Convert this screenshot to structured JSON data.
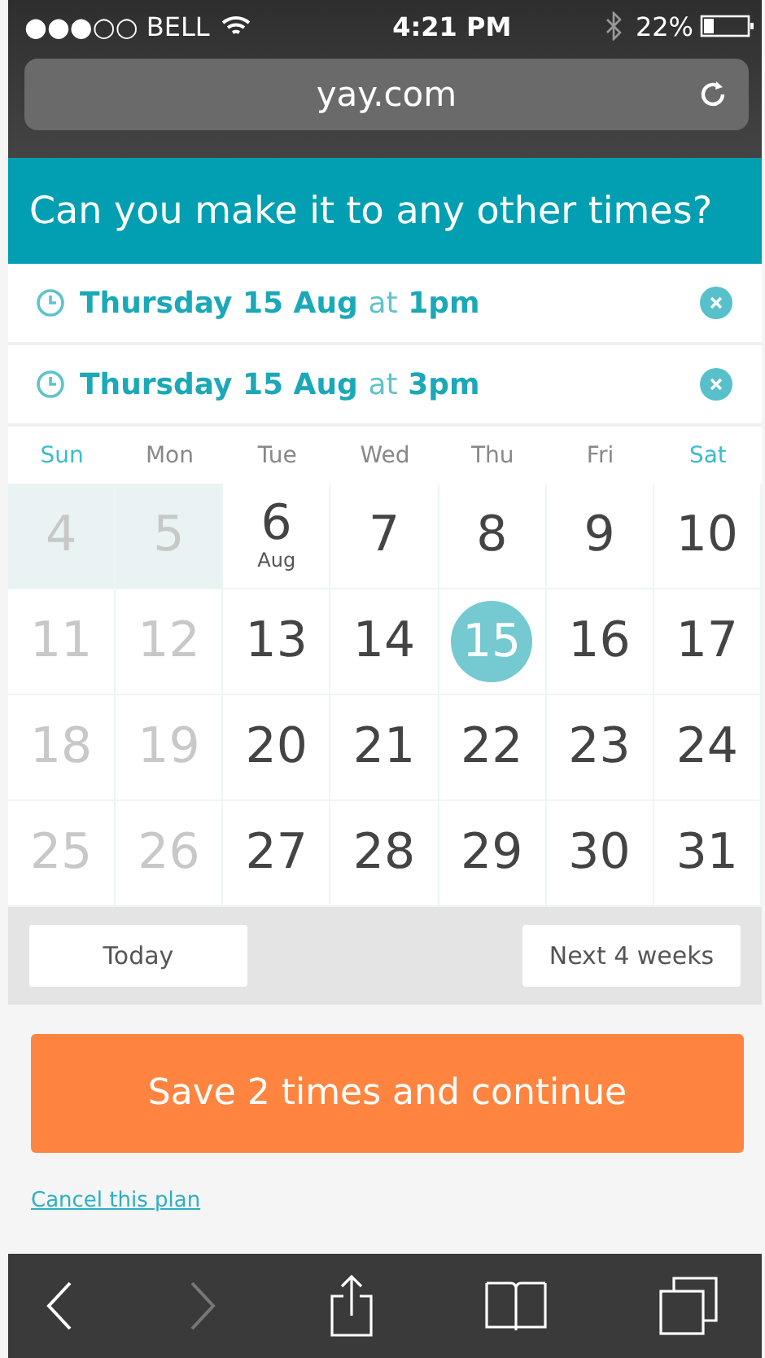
{
  "status_bar": {
    "carrier": "●●●○○ BELL",
    "time": "4:21 PM",
    "battery": "22%"
  },
  "url_bar": {
    "url": "yay.com"
  },
  "header": {
    "title": "Can you make it to any other times?"
  },
  "times": [
    {
      "date": "Thursday 15 Aug",
      "connector": "at",
      "time": "1pm"
    },
    {
      "date": "Thursday 15 Aug",
      "connector": "at",
      "time": "3pm"
    }
  ],
  "weekdays": [
    {
      "label": "Sun",
      "weekend": true
    },
    {
      "label": "Mon",
      "weekend": false
    },
    {
      "label": "Tue",
      "weekend": false
    },
    {
      "label": "Wed",
      "weekend": false
    },
    {
      "label": "Thu",
      "weekend": false
    },
    {
      "label": "Fri",
      "weekend": false
    },
    {
      "label": "Sat",
      "weekend": true
    }
  ],
  "days": [
    {
      "day": "4",
      "past": true,
      "shaded": true,
      "selected": false
    },
    {
      "day": "5",
      "past": true,
      "shaded": true,
      "selected": false
    },
    {
      "day": "6",
      "month": "Aug",
      "past": false,
      "shaded": false,
      "selected": false
    },
    {
      "day": "7",
      "past": false,
      "shaded": false,
      "selected": false
    },
    {
      "day": "8",
      "past": false,
      "shaded": false,
      "selected": false
    },
    {
      "day": "9",
      "past": false,
      "shaded": false,
      "selected": false
    },
    {
      "day": "10",
      "past": false,
      "shaded": false,
      "selected": false
    },
    {
      "day": "11",
      "past": true,
      "shaded": false,
      "selected": false
    },
    {
      "day": "12",
      "past": true,
      "shaded": false,
      "selected": false
    },
    {
      "day": "13",
      "past": false,
      "shaded": false,
      "selected": false
    },
    {
      "day": "14",
      "past": false,
      "shaded": false,
      "selected": false
    },
    {
      "day": "15",
      "past": false,
      "shaded": false,
      "selected": true
    },
    {
      "day": "16",
      "past": false,
      "shaded": false,
      "selected": false
    },
    {
      "day": "17",
      "past": false,
      "shaded": false,
      "selected": false
    },
    {
      "day": "18",
      "past": true,
      "shaded": false,
      "selected": false
    },
    {
      "day": "19",
      "past": true,
      "shaded": false,
      "selected": false
    },
    {
      "day": "20",
      "past": false,
      "shaded": false,
      "selected": false
    },
    {
      "day": "21",
      "past": false,
      "shaded": false,
      "selected": false
    },
    {
      "day": "22",
      "past": false,
      "shaded": false,
      "selected": false
    },
    {
      "day": "23",
      "past": false,
      "shaded": false,
      "selected": false
    },
    {
      "day": "24",
      "past": false,
      "shaded": false,
      "selected": false
    },
    {
      "day": "25",
      "past": true,
      "shaded": false,
      "selected": false
    },
    {
      "day": "26",
      "past": true,
      "shaded": false,
      "selected": false
    },
    {
      "day": "27",
      "past": false,
      "shaded": false,
      "selected": false
    },
    {
      "day": "28",
      "past": false,
      "shaded": false,
      "selected": false
    },
    {
      "day": "29",
      "past": false,
      "shaded": false,
      "selected": false
    },
    {
      "day": "30",
      "past": false,
      "shaded": false,
      "selected": false
    },
    {
      "day": "31",
      "past": false,
      "shaded": false,
      "selected": false
    }
  ],
  "nav_buttons": {
    "today": "Today",
    "next": "Next 4 weeks"
  },
  "save_button": "Save 2 times and continue",
  "cancel_link": "Cancel this plan",
  "toolbar": {
    "forward_disabled": true
  }
}
